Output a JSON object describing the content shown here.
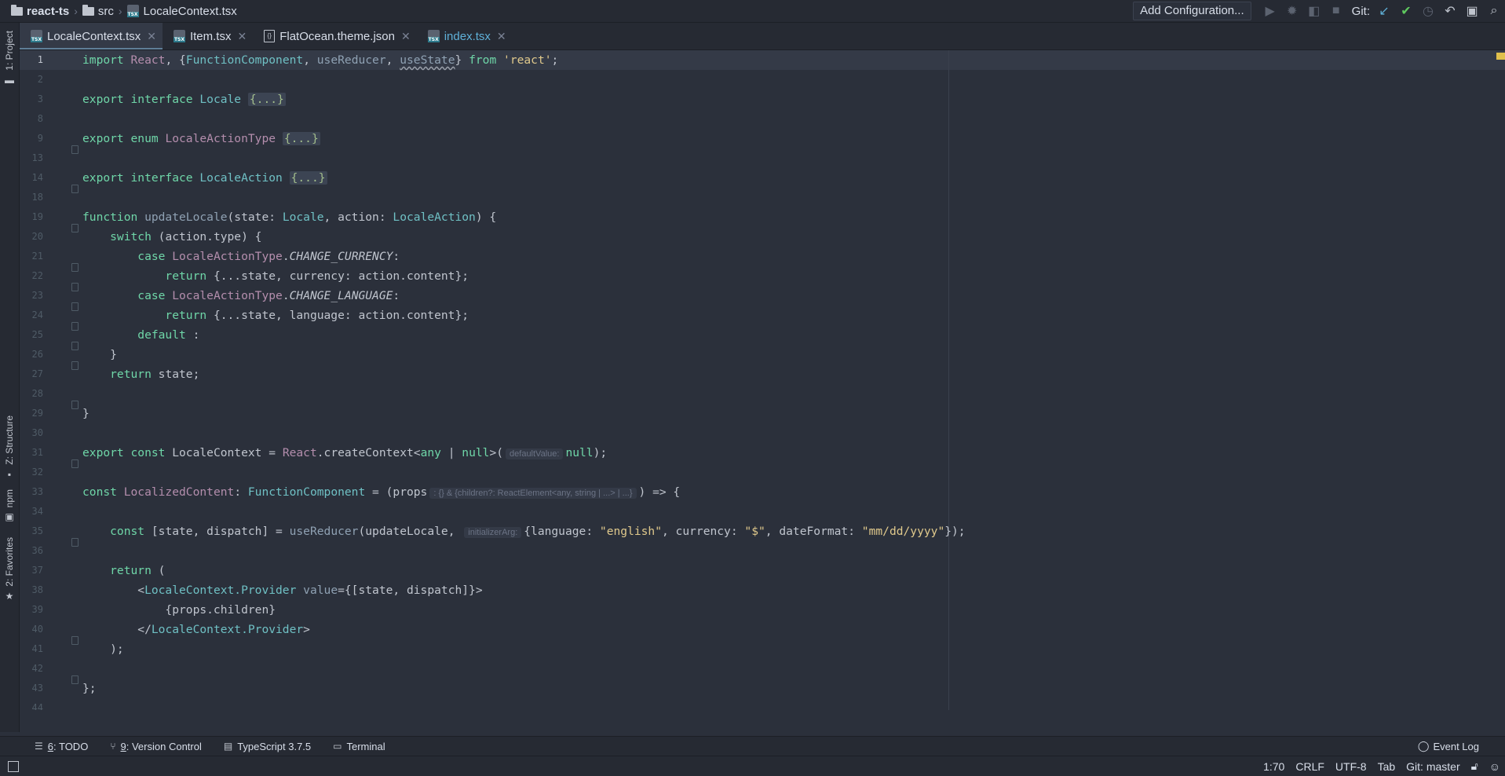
{
  "navbar": {
    "project": "react-ts",
    "folder": "src",
    "file": "LocaleContext.tsx",
    "add_configuration": "Add Configuration...",
    "git_label": "Git:"
  },
  "tool_strip": {
    "project": "1: Project",
    "structure": "Z: Structure",
    "npm": "npm",
    "favorites": "2: Favorites"
  },
  "tabs": [
    {
      "label": "LocaleContext.tsx",
      "icon": "tsx-file-icon",
      "active": true
    },
    {
      "label": "Item.tsx",
      "icon": "tsx-file-icon"
    },
    {
      "label": "FlatOcean.theme.json",
      "icon": "json-file-icon"
    },
    {
      "label": "index.tsx",
      "icon": "tsx-file-icon",
      "modified": true
    }
  ],
  "editor": {
    "line_numbers": [
      "1",
      "2",
      "3",
      "8",
      "9",
      "13",
      "14",
      "18",
      "19",
      "20",
      "21",
      "22",
      "23",
      "24",
      "25",
      "26",
      "27",
      "28",
      "29",
      "30",
      "31",
      "32",
      "33",
      "34",
      "35",
      "36",
      "37",
      "38",
      "39",
      "40",
      "41",
      "42",
      "43",
      "44"
    ],
    "hints": {
      "default_value": "defaultValue:",
      "props_type": ": {} & {children?: ReactElement<any, string | ...> | ...}",
      "initializer_arg": "initializerArg:"
    },
    "code": {
      "l1_a": "import ",
      "l1_b": "React",
      "l1_c": ", {",
      "l1_d": "FunctionComponent",
      "l1_e": ", ",
      "l1_f": "useReducer",
      "l1_g": ", ",
      "l1_h": "useState",
      "l1_i": "} ",
      "l1_j": "from ",
      "l1_k": "'react'",
      "l1_l": ";",
      "l3_a": "export interface ",
      "l3_b": "Locale ",
      "l3_c": "{...}",
      "l9_a": "export enum ",
      "l9_b": "LocaleActionType ",
      "l9_c": "{...}",
      "l14_a": "export interface ",
      "l14_b": "LocaleAction ",
      "l14_c": "{...}",
      "l19_a": "function ",
      "l19_b": "updateLocale",
      "l19_c": "(state: ",
      "l19_d": "Locale",
      "l19_e": ", action: ",
      "l19_f": "LocaleAction",
      "l19_g": ") {",
      "l20_a": "    switch ",
      "l20_b": "(action.type) {",
      "l21_a": "        case ",
      "l21_b": "LocaleActionType",
      "l21_c": ".",
      "l21_d": "CHANGE_CURRENCY",
      "l21_e": ":",
      "l22_a": "            return ",
      "l22_b": "{...state, currency: action.content};",
      "l23_a": "        case ",
      "l23_b": "LocaleActionType",
      "l23_c": ".",
      "l23_d": "CHANGE_LANGUAGE",
      "l23_e": ":",
      "l24_a": "            return ",
      "l24_b": "{...state, language: action.content};",
      "l25_a": "        default ",
      "l25_b": ":",
      "l26": "    }",
      "l27_a": "    return ",
      "l27_b": "state;",
      "l29": "}",
      "l31_a": "export const ",
      "l31_b": "LocaleContext = ",
      "l31_c": "React",
      "l31_d": ".createContext<",
      "l31_e": "any ",
      "l31_f": "| ",
      "l31_g": "null",
      "l31_h": ">(",
      "l31_i": "null",
      "l31_j": ");",
      "l33_a": "const ",
      "l33_b": "LocalizedContent",
      "l33_c": ": ",
      "l33_d": "FunctionComponent ",
      "l33_e": "= (props",
      "l33_f": ") => {",
      "l35_a": "    const ",
      "l35_b": "[state, dispatch] = ",
      "l35_c": "useReducer",
      "l35_d": "(updateLocale, ",
      "l35_e": "{language: ",
      "l35_f": "\"english\"",
      "l35_g": ", currency: ",
      "l35_h": "\"$\"",
      "l35_i": ", dateFormat: ",
      "l35_j": "\"mm/dd/yyyy\"",
      "l35_k": "});",
      "l37_a": "    return ",
      "l37_b": "(",
      "l38_a": "        <",
      "l38_b": "LocaleContext.Provider ",
      "l38_c": "value",
      "l38_d": "={[state, dispatch]}>",
      "l39": "            {props.children}",
      "l40_a": "        </",
      "l40_b": "LocaleContext.Provider",
      "l40_c": ">",
      "l41": "    );",
      "l43": "};"
    }
  },
  "bottom_tools": [
    {
      "num": "6",
      "rest": ": TODO",
      "icon": "list-icon"
    },
    {
      "num": "9",
      "rest": ": Version Control",
      "icon": "branch-icon"
    },
    {
      "label": "TypeScript 3.7.5",
      "icon": "typescript-icon"
    },
    {
      "label": "Terminal",
      "icon": "terminal-icon"
    }
  ],
  "event_log": "Event Log",
  "status": {
    "position": "1:70",
    "line_sep": "CRLF",
    "encoding": "UTF-8",
    "indent": "Tab",
    "git_branch": "Git: master"
  },
  "colors": {
    "background": "#2b303b",
    "keyword": "#6fd6a8",
    "type": "#b48ead",
    "string": "#e0c98c",
    "git_ok": "#5fc95f"
  }
}
